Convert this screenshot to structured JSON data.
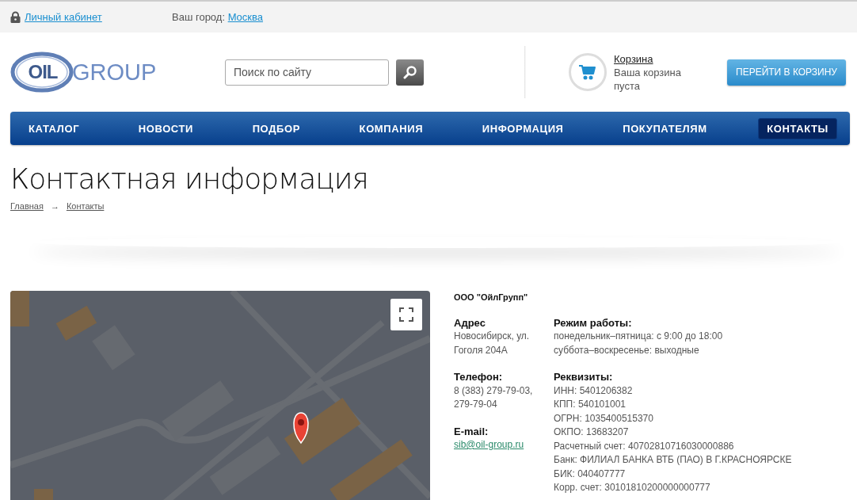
{
  "top_bar": {
    "account_link": "Личный кабинет",
    "city_label": "Ваш город:",
    "city_link": "Москва"
  },
  "header": {
    "logo": {
      "mark": "OIL",
      "word": "GROUP"
    },
    "search": {
      "placeholder": "Поиск по сайту"
    },
    "cart": {
      "title": "Корзина",
      "status": "Ваша корзина пуста",
      "button": "ПЕРЕЙТИ В КОРЗИНУ"
    }
  },
  "nav": [
    {
      "label": "КАТАЛОГ",
      "selected": false
    },
    {
      "label": "НОВОСТИ",
      "selected": false
    },
    {
      "label": "ПОДБОР",
      "selected": false
    },
    {
      "label": "КОМПАНИЯ",
      "selected": false
    },
    {
      "label": "ИНФОРМАЦИЯ",
      "selected": false
    },
    {
      "label": "ПОКУПАТЕЛЯМ",
      "selected": false
    },
    {
      "label": "КОНТАКТЫ",
      "selected": true
    }
  ],
  "page": {
    "title": "Контактная информация",
    "breadcrumbs": [
      "Главная",
      "Контакты"
    ],
    "breadcrumb_separator": "→"
  },
  "company": {
    "name": "ООО \"ОйлГрупп\"",
    "left": [
      {
        "label": "Адрес",
        "lines": [
          "Новосибирск, ул.",
          "Гоголя 204А"
        ],
        "kind": "text"
      },
      {
        "label": "Телефон:",
        "lines": [
          "8 (383) 279-79-03,",
          "279-79-04"
        ],
        "kind": "text"
      },
      {
        "label": "E-mail:",
        "lines": [
          "sib@oil-group.ru"
        ],
        "kind": "link"
      }
    ],
    "right": [
      {
        "label": "Режим работы:",
        "lines": [
          "понедельник–пятница:  с 9:00 до 18:00",
          "суббота–воскресенье: выходные"
        ],
        "kind": "text"
      },
      {
        "label": "Реквизиты:",
        "lines": [
          "ИНН: 5401206382",
          "КПП: 540101001",
          "ОГРН: 1035400515370",
          "ОКПО: 13683207",
          "Расчетный счет: 40702810716030000886",
          "Банк: ФИЛИАЛ БАНКА ВТБ (ПАО) В Г.КРАСНОЯРСКЕ",
          "БИК: 040407777",
          "Корр. счет: 30101810200000000777"
        ],
        "kind": "text"
      }
    ]
  }
}
